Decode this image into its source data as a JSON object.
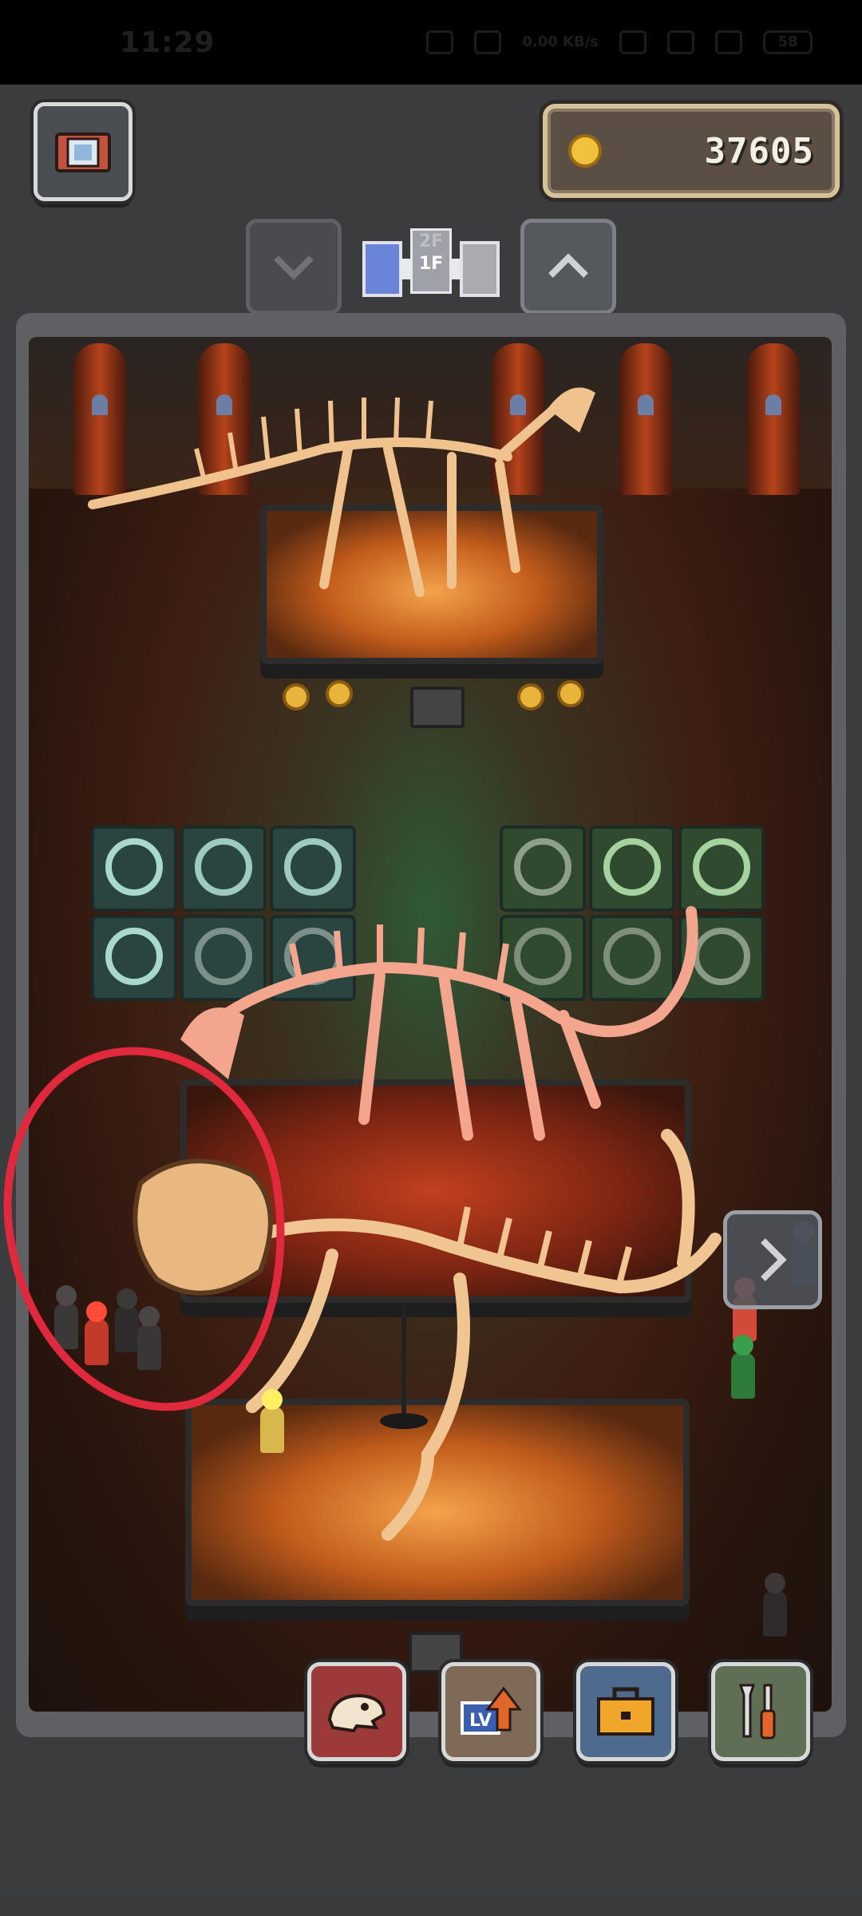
{
  "status_bar": {
    "time": "11:29",
    "network_speed": "0.00\nKB/s",
    "battery": "58"
  },
  "hud": {
    "coins": "37605",
    "floor": {
      "upper": "2F",
      "current": "1F"
    }
  },
  "toolbar": {
    "items": [
      {
        "icon": "fossil-skull-icon",
        "color": "#9c3a3a"
      },
      {
        "icon": "level-up-icon",
        "label": "LV",
        "color": "#7f6a58"
      },
      {
        "icon": "toolbox-icon",
        "color": "#4e6a8c"
      },
      {
        "icon": "wrench-screwdriver-icon",
        "color": "#5f6f56"
      }
    ]
  },
  "annotation": {
    "color": "#e0293d",
    "shape": "hand-drawn circle"
  },
  "colors": {
    "accent_gold": "#f0c23b",
    "floor_active": "#6a85d8",
    "room_glow": "#f3a34a"
  }
}
